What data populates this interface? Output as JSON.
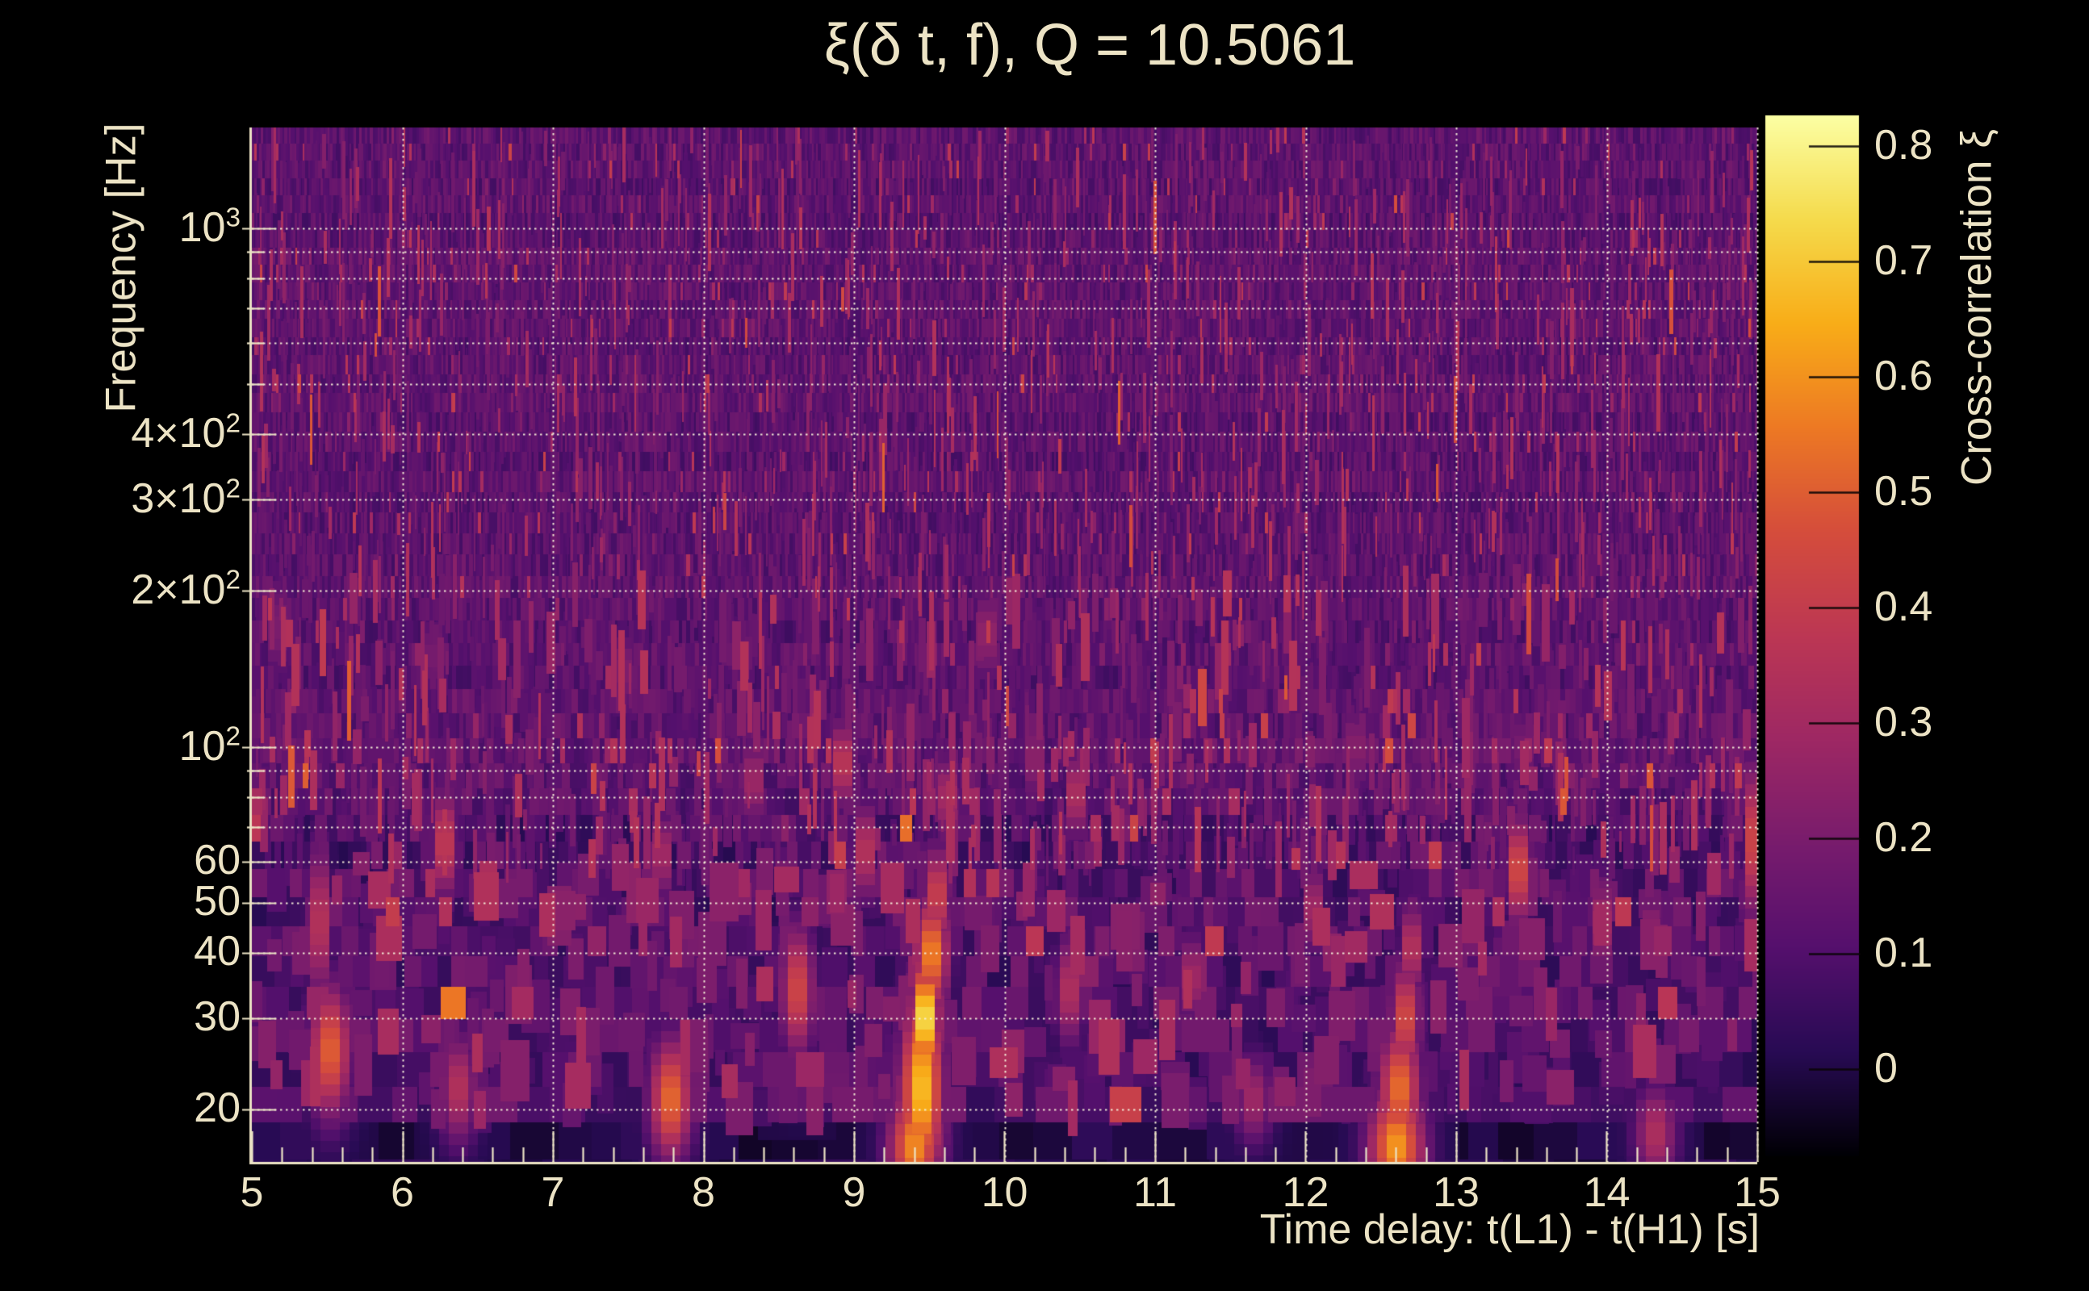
{
  "title": {
    "text": "ξ(δ t, f), Q = 10.5061"
  },
  "chart_data": {
    "type": "heatmap",
    "title": "ξ(δ t, f), Q = 10.5061",
    "q_value": 10.5061,
    "xlabel": "Time delay: t(L1) - t(H1) [s]",
    "ylabel": "Frequency [Hz]",
    "x_axis": {
      "scale": "linear",
      "min": 5,
      "max": 15,
      "major_ticks": [
        5,
        6,
        7,
        8,
        9,
        10,
        11,
        12,
        13,
        14,
        15
      ],
      "minor_tick_step": 0.2,
      "gridlines": [
        6,
        7,
        8,
        9,
        10,
        11,
        12,
        13,
        14,
        15
      ]
    },
    "y_axis": {
      "scale": "log",
      "min": 16,
      "max": 1570,
      "labeled_ticks": [
        {
          "f": 1000,
          "base": "10",
          "exp": "3"
        },
        {
          "f": 400,
          "base": "4×10",
          "exp": "2"
        },
        {
          "f": 300,
          "base": "3×10",
          "exp": "2"
        },
        {
          "f": 200,
          "base": "2×10",
          "exp": "2"
        },
        {
          "f": 100,
          "base": "10",
          "exp": "2"
        },
        {
          "f": 60,
          "base": "60",
          "exp": ""
        },
        {
          "f": 50,
          "base": "50",
          "exp": ""
        },
        {
          "f": 40,
          "base": "40",
          "exp": ""
        },
        {
          "f": 30,
          "base": "30",
          "exp": ""
        },
        {
          "f": 20,
          "base": "20",
          "exp": ""
        }
      ],
      "minor_tick_freqs": [
        70,
        80,
        90,
        500,
        600,
        700,
        800,
        900
      ],
      "gridline_freqs": [
        20,
        30,
        40,
        50,
        60,
        70,
        80,
        90,
        100,
        200,
        300,
        400,
        500,
        600,
        700,
        800,
        900,
        1000
      ]
    },
    "colorbar": {
      "label": "Cross-correlation ξ",
      "colormap": "inferno",
      "min": -0.075,
      "max": 0.827,
      "labeled_ticks": [
        0.8,
        0.7,
        0.6,
        0.5,
        0.4,
        0.3,
        0.2,
        0.1,
        0
      ]
    },
    "peak": {
      "t": 9.47,
      "f": 30,
      "xi": 0.82
    },
    "background_noise": {
      "typical_xi_range": [
        0.0,
        0.2
      ],
      "description": "dark purple field with vertical streak noise; fine needles at high frequency, wide blocky cells at low frequency"
    },
    "hotspot_columns": [
      "t_seconds",
      "freq_hz",
      "sigma_t_s",
      "sigma_f_octaves",
      "xi"
    ],
    "hotspots": [
      [
        9.4,
        17,
        0.12,
        0.5,
        0.6
      ],
      [
        9.45,
        22,
        0.1,
        0.8,
        0.7
      ],
      [
        9.47,
        30,
        0.065,
        0.5,
        0.82
      ],
      [
        9.51,
        40,
        0.08,
        0.5,
        0.6
      ],
      [
        9.55,
        52,
        0.06,
        0.45,
        0.46
      ],
      [
        9.62,
        80,
        0.035,
        0.4,
        0.45
      ],
      [
        9.07,
        63,
        0.05,
        0.45,
        0.42
      ],
      [
        12.6,
        17,
        0.13,
        0.5,
        0.62
      ],
      [
        12.62,
        22,
        0.1,
        0.55,
        0.55
      ],
      [
        12.66,
        30,
        0.07,
        0.5,
        0.48
      ],
      [
        12.7,
        41,
        0.055,
        0.4,
        0.4
      ],
      [
        5.52,
        26,
        0.1,
        0.6,
        0.52
      ],
      [
        5.45,
        46,
        0.05,
        0.7,
        0.42
      ],
      [
        7.78,
        21,
        0.1,
        0.55,
        0.54
      ],
      [
        8.62,
        34,
        0.08,
        0.6,
        0.46
      ],
      [
        6.28,
        65,
        0.05,
        0.5,
        0.46
      ],
      [
        8.92,
        93,
        0.04,
        0.4,
        0.5
      ],
      [
        10.47,
        81,
        0.04,
        0.4,
        0.44
      ],
      [
        13.41,
        58,
        0.06,
        0.5,
        0.5
      ],
      [
        14.98,
        66,
        0.05,
        0.7,
        0.52
      ],
      [
        9.88,
        165,
        0.03,
        0.45,
        0.44
      ],
      [
        13.97,
        46,
        0.05,
        0.45,
        0.36
      ],
      [
        6.37,
        22,
        0.09,
        0.5,
        0.36
      ],
      [
        10.43,
        34,
        0.07,
        0.5,
        0.36
      ],
      [
        11.24,
        36,
        0.06,
        0.4,
        0.33
      ],
      [
        7.46,
        140,
        0.03,
        0.4,
        0.38
      ],
      [
        12.05,
        49,
        0.05,
        0.4,
        0.35
      ],
      [
        14.32,
        18,
        0.1,
        0.45,
        0.34
      ],
      [
        8.33,
        86,
        0.04,
        0.4,
        0.38
      ],
      [
        5.17,
        170,
        0.03,
        0.5,
        0.36
      ],
      [
        12.33,
        100,
        0.03,
        0.4,
        0.4
      ],
      [
        7.72,
        62,
        0.04,
        0.4,
        0.4
      ],
      [
        6.2,
        150,
        0.03,
        0.4,
        0.34
      ],
      [
        11.65,
        21,
        0.09,
        0.4,
        0.3
      ],
      [
        10.2,
        95,
        0.035,
        0.4,
        0.36
      ],
      [
        13.45,
        100,
        0.03,
        0.4,
        0.34
      ]
    ],
    "style": {
      "text_color": "#ece3c5",
      "grid_color": "#f6efd9",
      "axis_color": "#ece3c5",
      "background": "#000000"
    }
  }
}
